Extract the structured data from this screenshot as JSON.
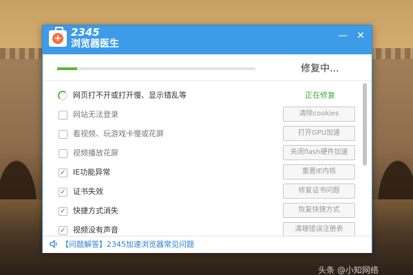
{
  "app": {
    "brand_number": "2345",
    "brand_name": "浏览器医生",
    "minimize_glyph": "—",
    "close_glyph": "✕"
  },
  "progress": {
    "fraction": 0.1,
    "status": "修复中..."
  },
  "colors": {
    "titlebar": "#3d9be8",
    "progress_fill": "#5cb82e",
    "status_green": "#3aa93a",
    "link_blue": "#2a7fd4"
  },
  "items": [
    {
      "label": "网页打不开或打开慢、显示错乱等",
      "state": "repairing",
      "status": "正在修复",
      "button": ""
    },
    {
      "label": "网站无法登录",
      "state": "unchecked",
      "status": "",
      "button": "清除cookies"
    },
    {
      "label": "看视频、玩游戏卡慢或花屏",
      "state": "unchecked",
      "status": "",
      "button": "打开GPU加速"
    },
    {
      "label": "视频播放花屏",
      "state": "unchecked",
      "status": "",
      "button": "关闭flash硬件加速"
    },
    {
      "label": "IE功能异常",
      "state": "checked",
      "status": "",
      "button": "重置IE内核"
    },
    {
      "label": "证书失效",
      "state": "checked",
      "status": "",
      "button": "修复证书问题"
    },
    {
      "label": "快捷方式消失",
      "state": "checked",
      "status": "",
      "button": "恢复快捷方式"
    },
    {
      "label": "视频没有声音",
      "state": "checked",
      "status": "",
      "button": "清理错误注册表"
    }
  ],
  "footer": {
    "icon": "speaker-icon",
    "link": "【问题解答】2345加速浏览器常见问题"
  },
  "watermark": "头条 @小知网络"
}
